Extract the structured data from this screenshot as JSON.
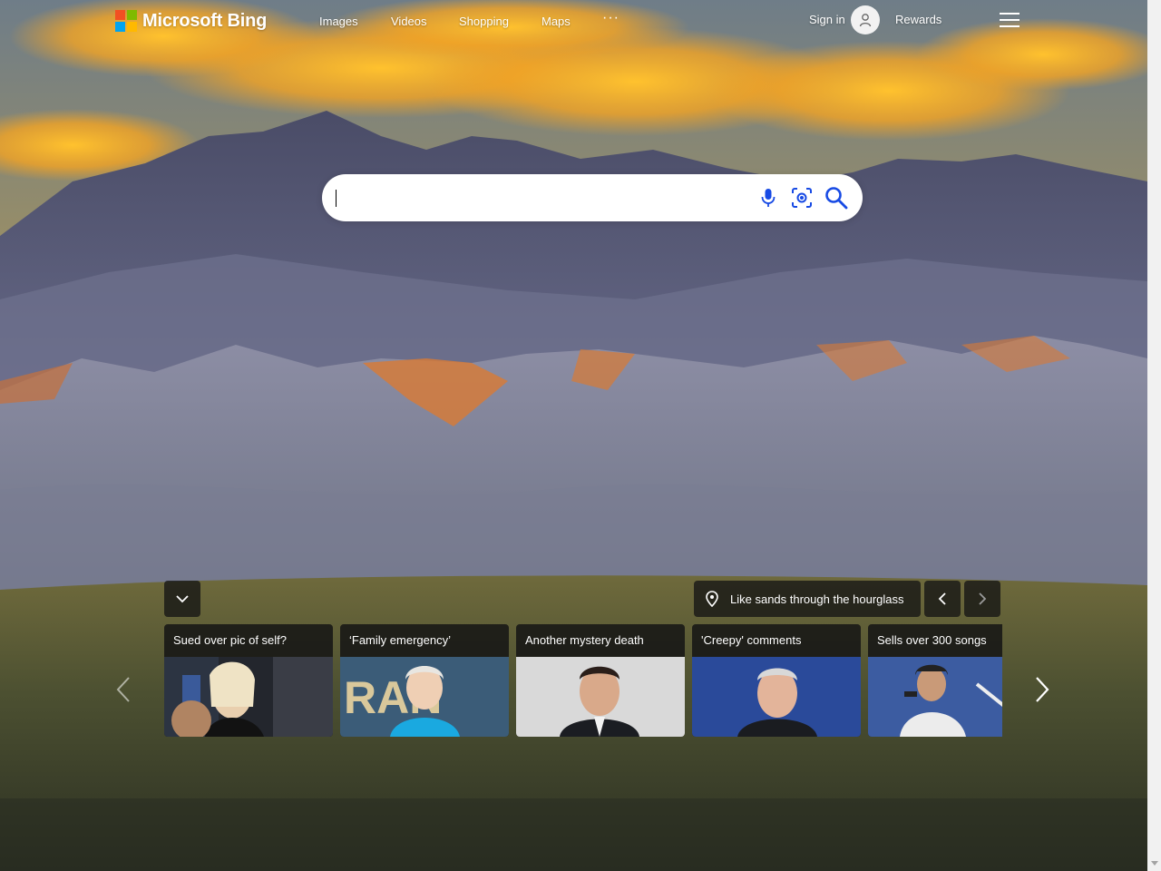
{
  "header": {
    "logo_text": "Microsoft Bing",
    "nav": [
      {
        "label": "Images"
      },
      {
        "label": "Videos"
      },
      {
        "label": "Shopping"
      },
      {
        "label": "Maps"
      }
    ],
    "more_label": "···",
    "sign_in_label": "Sign in",
    "rewards_label": "Rewards",
    "icons": [
      "microsoft-logo-icon",
      "avatar-icon",
      "hamburger-menu-icon"
    ]
  },
  "search": {
    "value": "",
    "placeholder": "",
    "icons": [
      "microphone-icon",
      "visual-search-icon",
      "search-icon"
    ]
  },
  "image_of_day": {
    "location_label": "Like sands through the hourglass",
    "icons": [
      "location-pin-icon",
      "chevron-left-icon",
      "chevron-right-icon",
      "chevron-down-icon"
    ]
  },
  "news": {
    "cards": [
      {
        "title": "Sued over pic of self?"
      },
      {
        "title": "‘Family emergency’"
      },
      {
        "title": "Another mystery death"
      },
      {
        "title": "'Creepy' comments"
      },
      {
        "title": "Sells over 300 songs"
      }
    ]
  },
  "colors": {
    "sky_gold": "#f0a21c",
    "mountain": "#5b5e7a",
    "dune": "#8e8fa6",
    "grass": "#5f6136",
    "panel": "#141414"
  }
}
